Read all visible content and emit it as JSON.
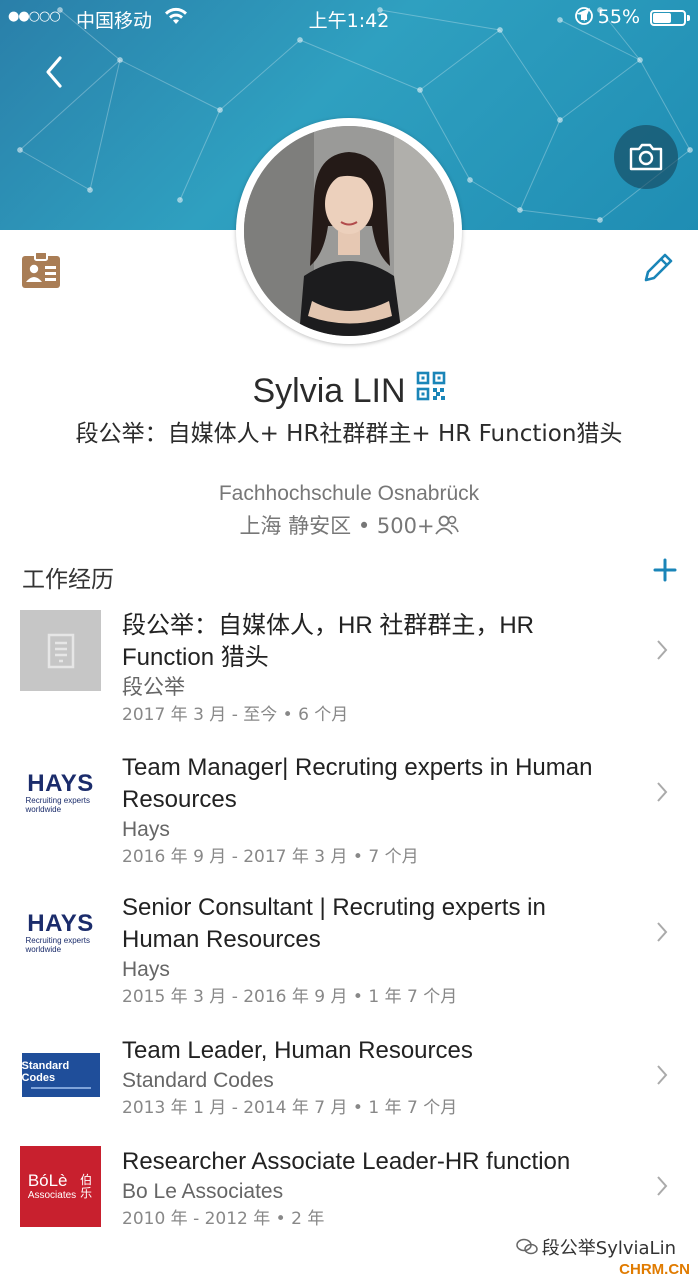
{
  "status_bar": {
    "signal": "●●○○○",
    "carrier": "中国移动",
    "time": "上午1:42",
    "battery": "55%"
  },
  "profile": {
    "name": "Sylvia LIN",
    "headline": "段公举：自媒体人+ HR社群群主+ HR Function猎头",
    "school": "Fachhochschule Osnabrück",
    "location": "上海 静安区",
    "connections": "500+"
  },
  "experience": {
    "section_title": "工作经历",
    "items": [
      {
        "title": "段公举：自媒体人，HR 社群群主，HR Function 猎头",
        "company": "段公举",
        "dates": "2017 年 3 月 - 至今 • 6 个月",
        "logo": "building-placeholder"
      },
      {
        "title": "Team Manager| Recruting experts in Human Resources",
        "company": "Hays",
        "dates": "2016 年 9 月 - 2017 年 3 月 • 7 个月",
        "logo": "hays",
        "logo_text": "HAYS",
        "logo_tagline": "Recruiting experts worldwide"
      },
      {
        "title": "Senior Consultant | Recruting experts in Human Resources",
        "company": "Hays",
        "dates": "2015 年 3 月 - 2016 年 9 月 • 1 年 7 个月",
        "logo": "hays",
        "logo_text": "HAYS",
        "logo_tagline": "Recruiting experts worldwide"
      },
      {
        "title": "Team Leader, Human Resources",
        "company": "Standard Codes",
        "dates": "2013 年 1 月 - 2014 年 7 月 • 1 年 7 个月",
        "logo": "standard-codes",
        "logo_text": "Standard Codes"
      },
      {
        "title": "Researcher Associate Leader-HR function",
        "company": "Bo Le Associates",
        "dates": "2010 年 - 2012 年 • 2 年",
        "logo": "bole",
        "logo_text": "BóLè",
        "logo_sub": "Associates",
        "logo_cjk": "伯乐"
      }
    ]
  },
  "watermark": {
    "text": "段公举SylviaLin",
    "site": "CHRM.CN"
  },
  "colors": {
    "banner": "#2a8fb5",
    "accent": "#0a7fb5",
    "id_icon": "#a97d55",
    "bole_red": "#c8202e",
    "standard_blue": "#1f4e9a",
    "hays_navy": "#1b2c6b"
  }
}
